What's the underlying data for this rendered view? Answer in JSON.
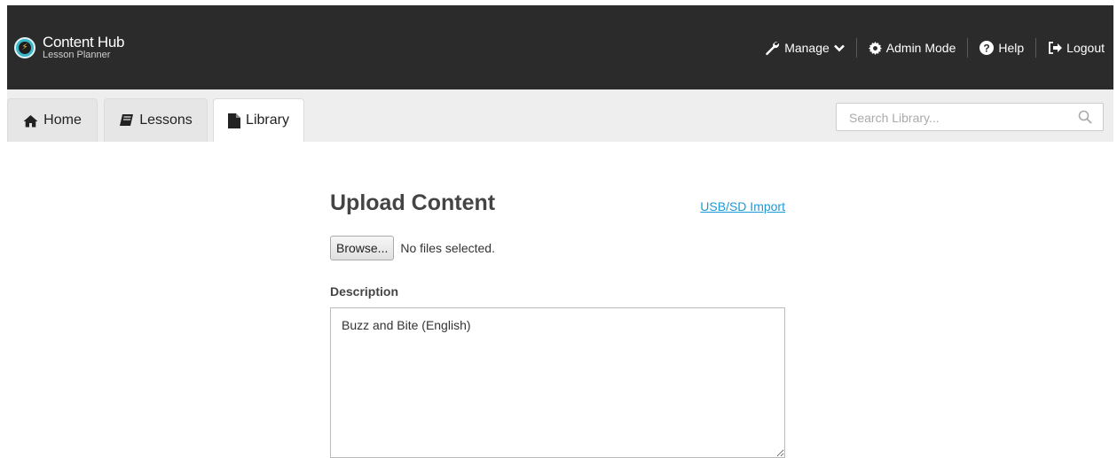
{
  "header": {
    "app_title": "Content Hub",
    "app_subtitle": "Lesson Planner",
    "nav": {
      "manage_label": "Manage",
      "admin_label": "Admin Mode",
      "help_label": "Help",
      "logout_label": "Logout"
    }
  },
  "tabs": [
    {
      "label": "Home",
      "icon": "home-icon",
      "active": false
    },
    {
      "label": "Lessons",
      "icon": "book-icon",
      "active": false
    },
    {
      "label": "Library",
      "icon": "file-icon",
      "active": true
    }
  ],
  "search": {
    "placeholder": "Search Library...",
    "value": ""
  },
  "upload": {
    "title": "Upload Content",
    "import_link": "USB/SD Import",
    "browse_label": "Browse...",
    "file_status": "No files selected.",
    "description_label": "Description",
    "description_value": "Buzz and Bite (English)"
  },
  "colors": {
    "header_bg": "#2b2b2b",
    "tabbar_bg": "#eeeeee",
    "link": "#1a9ad6",
    "logo_accent": "#3bb7c9"
  }
}
